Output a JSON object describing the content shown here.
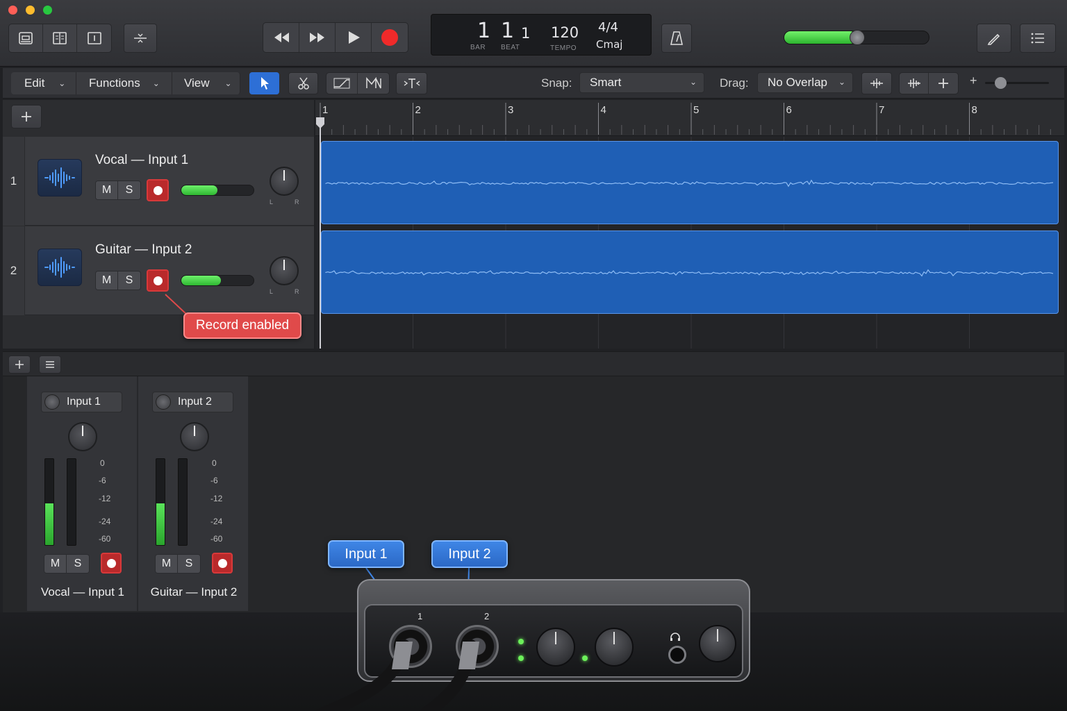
{
  "window": {
    "traffic_lights": [
      "close",
      "minimize",
      "zoom"
    ]
  },
  "control_bar": {
    "view_buttons": [
      "library-icon",
      "inspector-icon",
      "editor-icon"
    ],
    "transport": [
      "rewind-icon",
      "fast-forward-icon",
      "play-icon",
      "record-icon"
    ],
    "lcd": {
      "bar": "1",
      "beat": "1",
      "sub": "1",
      "bar_label": "BAR",
      "beat_label": "BEAT",
      "tempo": "120",
      "tempo_label": "TEMPO",
      "time_signature": "4/4",
      "key": "Cmaj"
    },
    "master_volume_fraction": 0.5
  },
  "toolbar": {
    "menus": [
      {
        "label": "Edit"
      },
      {
        "label": "Functions"
      },
      {
        "label": "View"
      }
    ],
    "snap_label": "Snap:",
    "snap_value": "Smart",
    "drag_label": "Drag:",
    "drag_value": "No Overlap"
  },
  "ruler": {
    "bars": [
      "1",
      "2",
      "3",
      "4",
      "5",
      "6",
      "7",
      "8"
    ]
  },
  "tracks": [
    {
      "number": "1",
      "name": "Vocal — Input 1",
      "mute": "M",
      "solo": "S",
      "record_enabled": true,
      "volume_fraction": 0.5,
      "pan_l": "L",
      "pan_r": "R"
    },
    {
      "number": "2",
      "name": "Guitar — Input 2",
      "mute": "M",
      "solo": "S",
      "record_enabled": true,
      "volume_fraction": 0.55,
      "pan_l": "L",
      "pan_r": "R"
    }
  ],
  "callout": {
    "text": "Record enabled"
  },
  "mixer": {
    "strips": [
      {
        "input": "Input 1",
        "name": "Vocal — Input 1",
        "mute": "M",
        "solo": "S",
        "meter_level_fraction": 0.48
      },
      {
        "input": "Input 2",
        "name": "Guitar — Input 2",
        "mute": "M",
        "solo": "S",
        "meter_level_fraction": 0.48
      }
    ],
    "scale": [
      "0",
      "-6",
      "-12",
      "-24",
      "-60"
    ]
  },
  "interface": {
    "bubble_1": "Input 1",
    "bubble_2": "Input 2",
    "port_1": "1",
    "port_2": "2"
  },
  "colors": {
    "accent_green": "#3fcf3f",
    "record_red": "#e5302f",
    "region_blue": "#1f5fb5",
    "callout_blue": "#3a7fe0"
  }
}
